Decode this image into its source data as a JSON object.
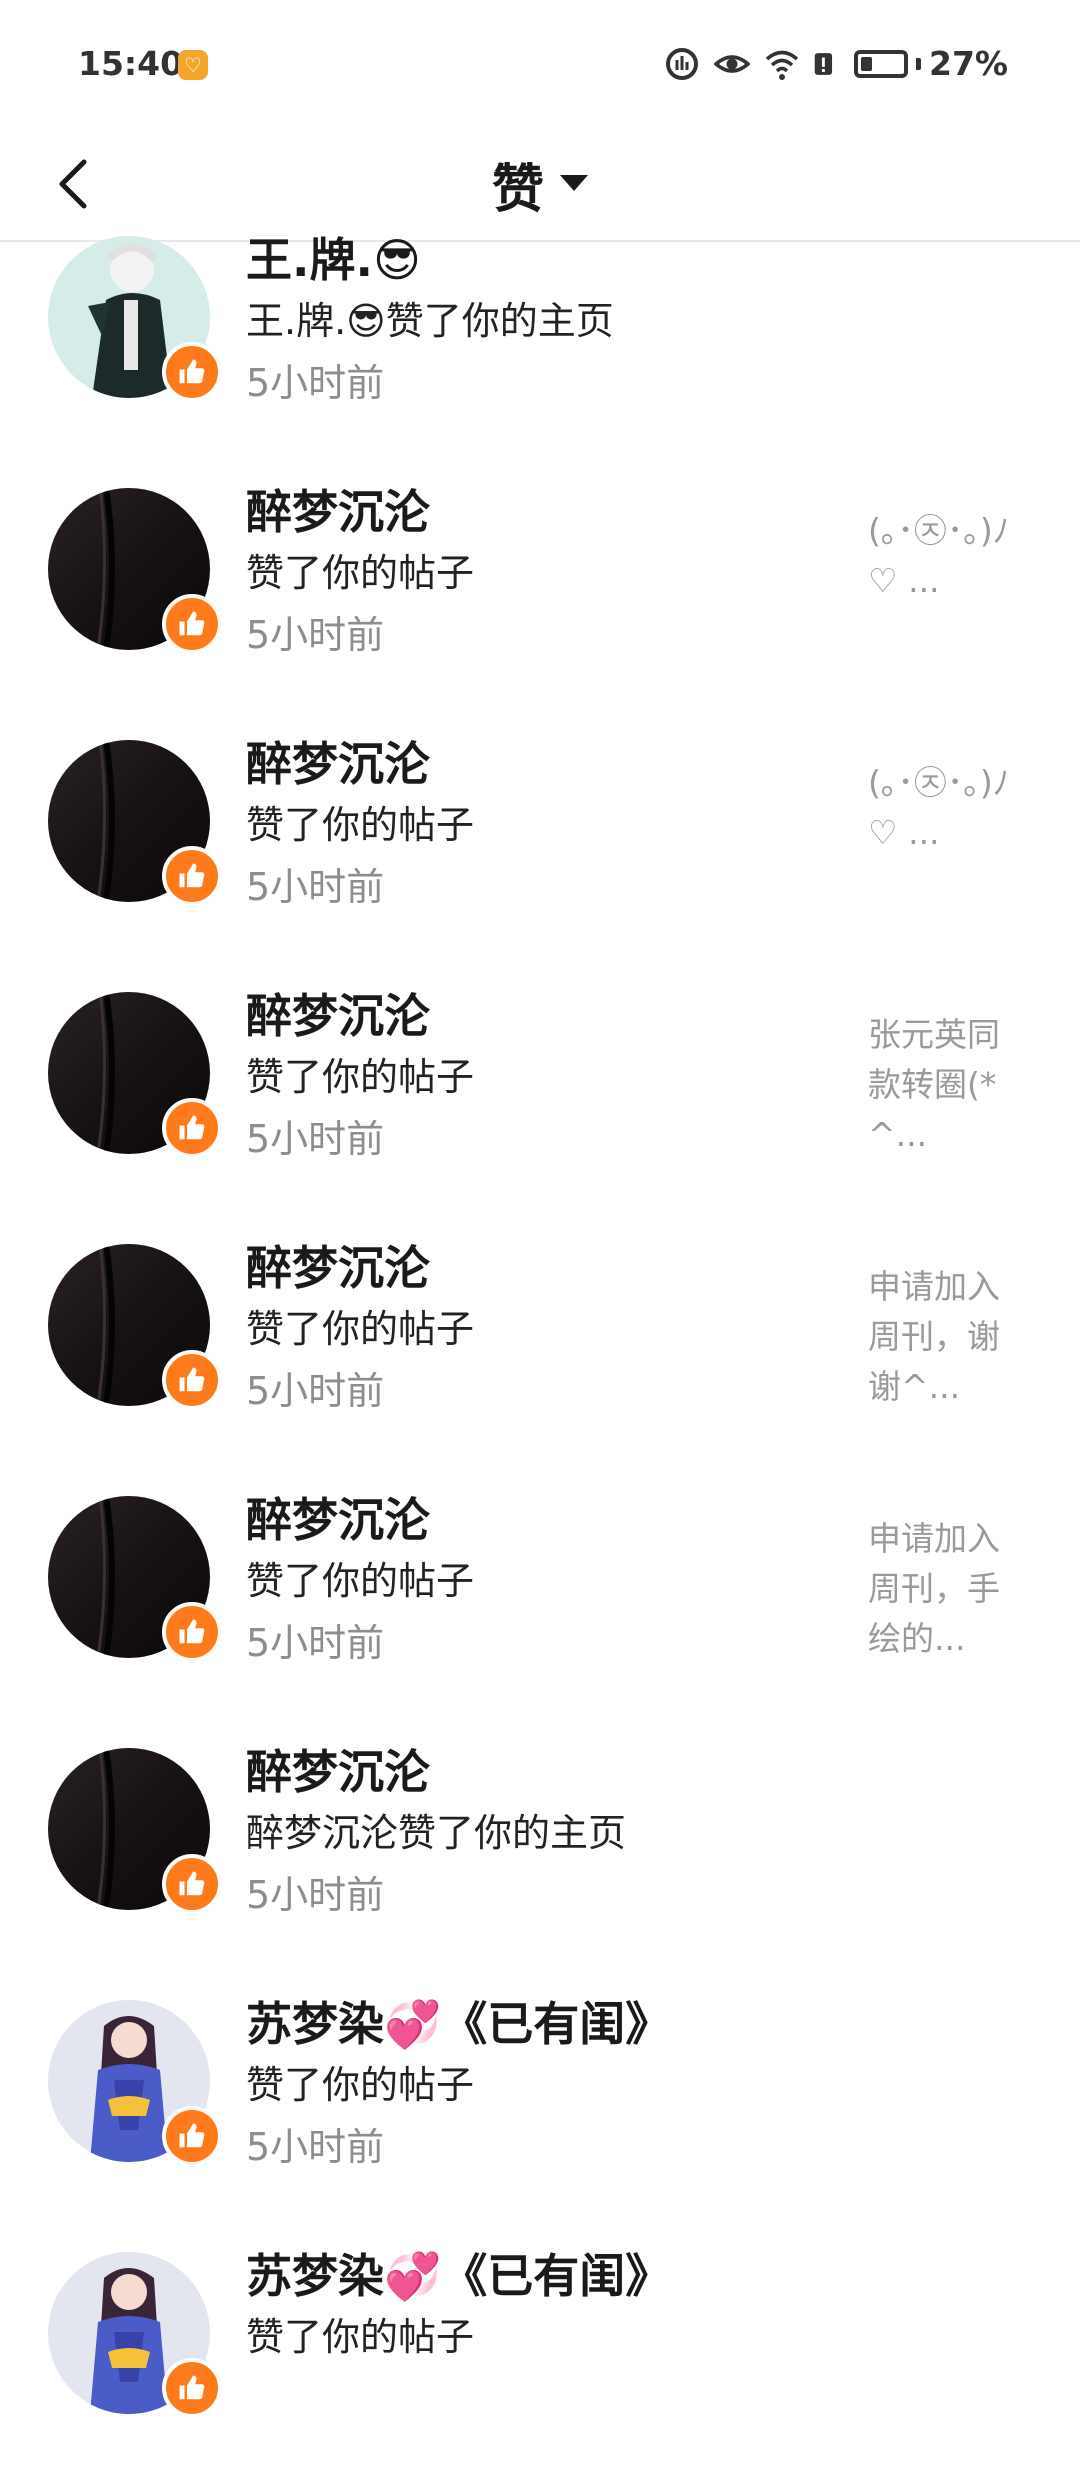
{
  "status_bar": {
    "time": "15:40",
    "battery": "27%",
    "battery_level": 0.27,
    "icons": [
      "data-saver-icon",
      "eye-icon",
      "wifi-icon",
      "alert-icon",
      "battery-icon"
    ]
  },
  "header": {
    "title": "赞",
    "back_icon": "chevron-left-icon",
    "dropdown_icon": "caret-down-icon"
  },
  "colors": {
    "accent": "#ff7a1a",
    "muted": "#8d8d8d",
    "divider": "#e8e8e8"
  },
  "notifications": [
    {
      "name": "王.牌.😎",
      "action": "王.牌.😎赞了你的主页",
      "time": "5小时前",
      "preview": "",
      "avatar": "anime-character-light"
    },
    {
      "name": "醉梦沉沦",
      "action": "赞了你的帖子",
      "time": "5小时前",
      "preview": "(｡･㉨･｡)ﾉ♡ ...",
      "avatar": "dark-fabric"
    },
    {
      "name": "醉梦沉沦",
      "action": "赞了你的帖子",
      "time": "5小时前",
      "preview": "(｡･㉨･｡)ﾉ♡ ...",
      "avatar": "dark-fabric"
    },
    {
      "name": "醉梦沉沦",
      "action": "赞了你的帖子",
      "time": "5小时前",
      "preview": "张元英同款转圈(*^...",
      "avatar": "dark-fabric"
    },
    {
      "name": "醉梦沉沦",
      "action": "赞了你的帖子",
      "time": "5小时前",
      "preview": "申请加入周刊，谢谢^...",
      "avatar": "dark-fabric"
    },
    {
      "name": "醉梦沉沦",
      "action": "赞了你的帖子",
      "time": "5小时前",
      "preview": "申请加入周刊，手绘的...",
      "avatar": "dark-fabric"
    },
    {
      "name": "醉梦沉沦",
      "action": "醉梦沉沦赞了你的主页",
      "time": "5小时前",
      "preview": "",
      "avatar": "dark-fabric"
    },
    {
      "name": "苏梦染💞《已有闺》",
      "action": "赞了你的帖子",
      "time": "5小时前",
      "preview": "",
      "avatar": "anime-character-purple"
    },
    {
      "name": "苏梦染💞《已有闺》",
      "action": "赞了你的帖子",
      "time": "",
      "preview": "",
      "avatar": "anime-character-purple"
    }
  ]
}
